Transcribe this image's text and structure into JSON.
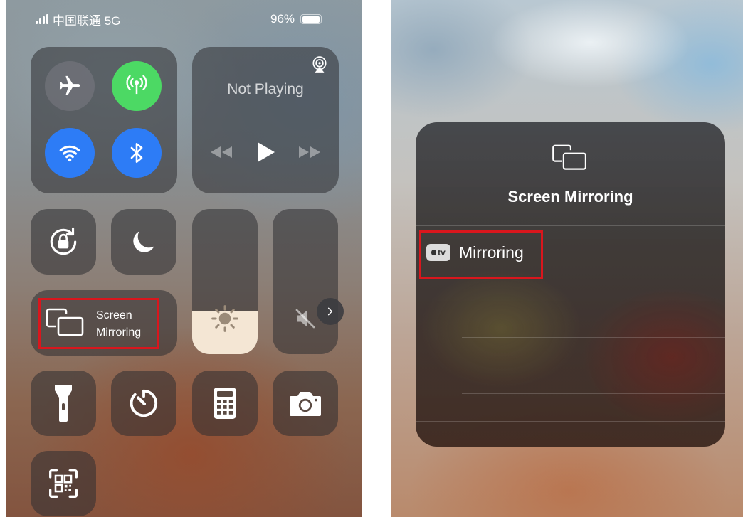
{
  "left_panel": {
    "status_bar": {
      "carrier": "中国联通 5G",
      "battery": "96%",
      "battery_level": 0.96
    },
    "media": {
      "status": "Not Playing"
    },
    "screen_mirroring": {
      "line1": "Screen",
      "line2": "Mirroring"
    },
    "brightness_level": 0.3,
    "volume_level": 0.0
  },
  "right_panel": {
    "title": "Screen Mirroring",
    "devices": [
      {
        "badge": "tv",
        "name": "Mirroring"
      }
    ]
  },
  "colors": {
    "highlight_red": "#d9161d",
    "cellular_green": "#4cd964",
    "active_blue": "#2d7cf6"
  }
}
